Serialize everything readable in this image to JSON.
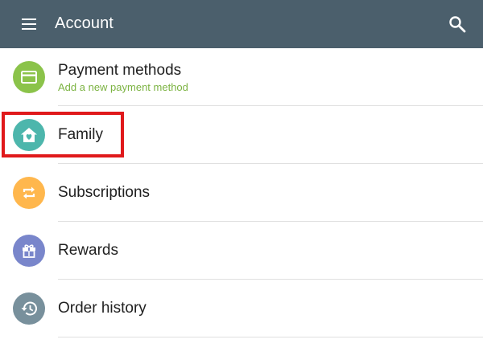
{
  "toolbar": {
    "title": "Account",
    "menu_icon": "menu-icon",
    "search_icon": "search-icon",
    "background": "#4b5f6c"
  },
  "items": [
    {
      "label": "Payment methods",
      "subtitle": "Add a new payment method",
      "icon": "credit-card-icon",
      "color": "#8bc34a",
      "subtitle_color": "#7cb342"
    },
    {
      "label": "Family",
      "icon": "family-home-icon",
      "color": "#4db6ac",
      "highlighted": true
    },
    {
      "label": "Subscriptions",
      "icon": "repeat-icon",
      "color": "#ffb74d"
    },
    {
      "label": "Rewards",
      "icon": "gift-icon",
      "color": "#7986cb"
    },
    {
      "label": "Order history",
      "icon": "history-icon",
      "color": "#78909c"
    }
  ],
  "highlight_color": "#e0191b"
}
